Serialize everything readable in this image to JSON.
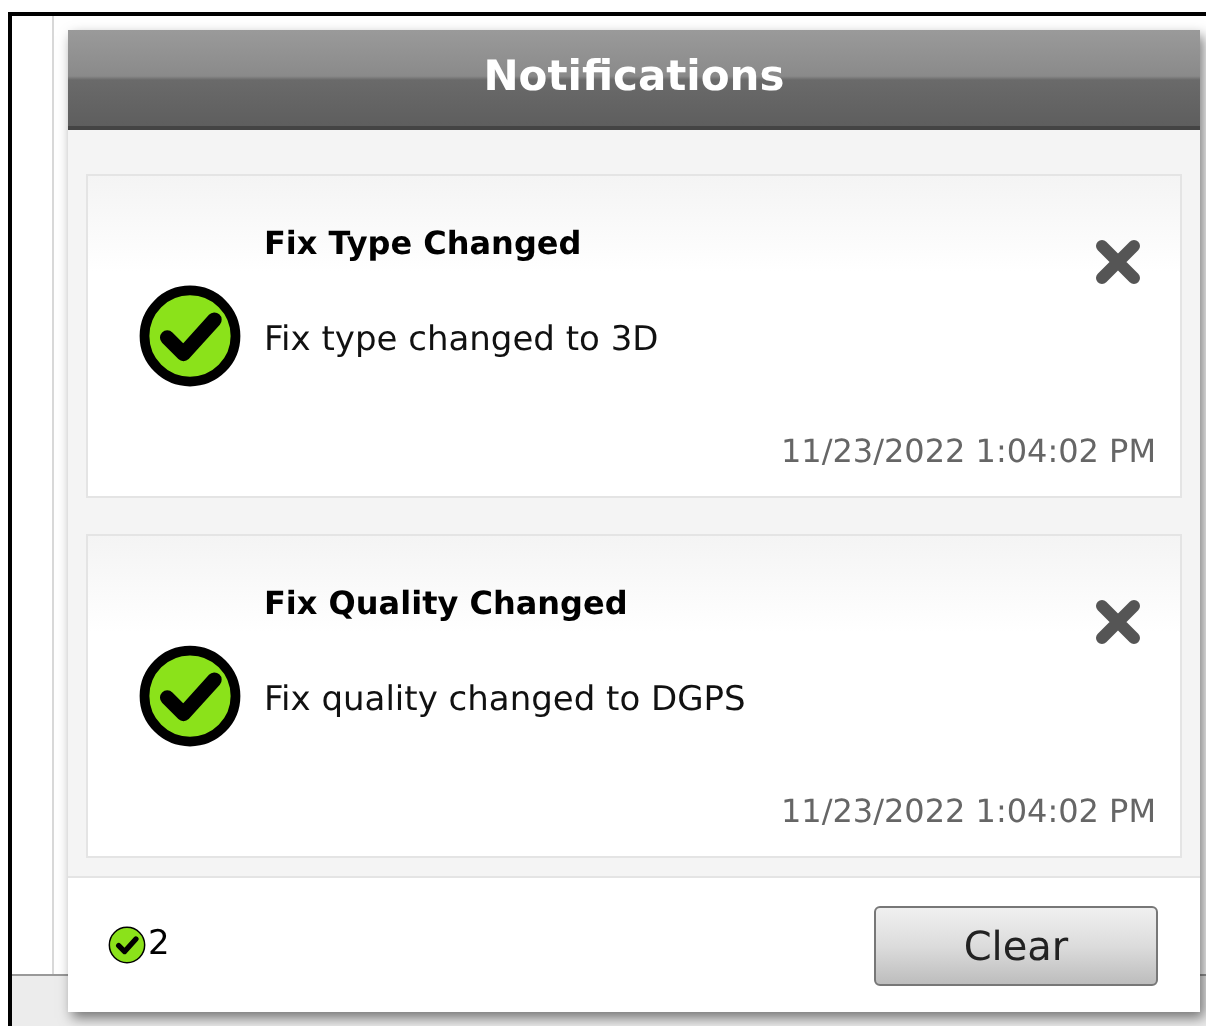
{
  "panel": {
    "title": "Notifications"
  },
  "notifications": [
    {
      "kind": "success",
      "title": "Fix Type Changed",
      "message": "Fix type changed to 3D",
      "time": "11/23/2022 1:04:02 PM"
    },
    {
      "kind": "success",
      "title": "Fix Quality Changed",
      "message": "Fix quality changed to DGPS",
      "time": "11/23/2022 1:04:02 PM"
    }
  ],
  "footer": {
    "kind": "success",
    "count": "2",
    "button": "Clear"
  }
}
